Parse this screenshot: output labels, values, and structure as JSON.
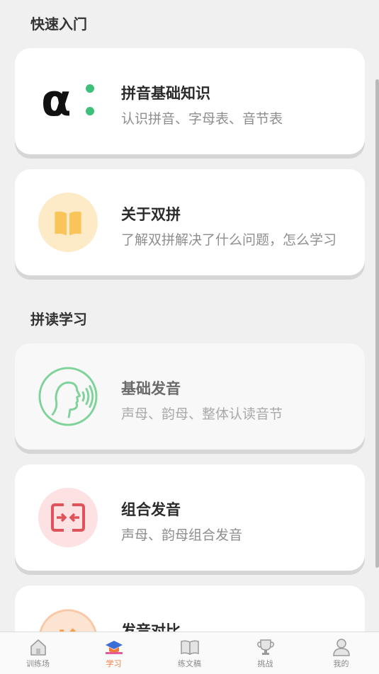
{
  "sections": {
    "quick_start": "快速入门",
    "pinyin_reading": "拼读学习"
  },
  "cards": [
    {
      "title": "拼音基础知识",
      "subtitle": "认识拼音、字母表、音节表",
      "icon": "alpha-colon-icon"
    },
    {
      "title": "关于双拼",
      "subtitle": "了解双拼解决了什么问题，怎么学习",
      "icon": "open-book-icon"
    },
    {
      "title": "基础发音",
      "subtitle": "声母、韵母、整体认读音节",
      "icon": "speaking-head-icon"
    },
    {
      "title": "组合发音",
      "subtitle": "声母、韵母组合发音",
      "icon": "merge-arrows-icon"
    },
    {
      "title": "发音对比",
      "subtitle": "",
      "icon": "compare-icon"
    }
  ],
  "tabs": [
    {
      "label": "训练场",
      "icon": "house-icon",
      "active": false
    },
    {
      "label": "学习",
      "icon": "graduation-cap-icon",
      "active": true
    },
    {
      "label": "练文稿",
      "icon": "book-icon",
      "active": false
    },
    {
      "label": "挑战",
      "icon": "trophy-icon",
      "active": false
    },
    {
      "label": "我的",
      "icon": "user-icon",
      "active": false
    }
  ],
  "colors": {
    "accent": "#f07a3a",
    "green": "#3cc07a",
    "yellow": "#f9c458",
    "red": "#e0525a"
  }
}
